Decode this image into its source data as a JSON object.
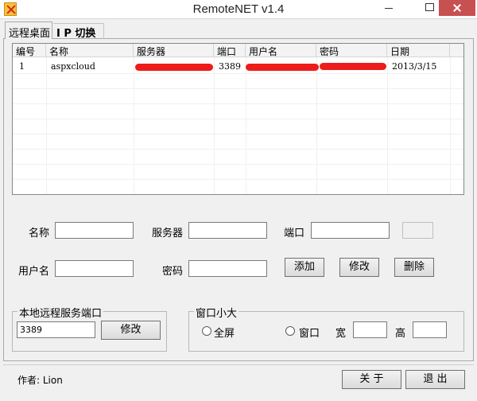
{
  "window": {
    "title": "RemoteNET v1.4"
  },
  "tabs": [
    {
      "label": "远程桌面"
    },
    {
      "label": "I P 切换"
    }
  ],
  "list": {
    "columns": [
      "编号",
      "名称",
      "服务器",
      "端口",
      "用户名",
      "密码",
      "日期"
    ],
    "rows": [
      {
        "id": "1",
        "name": "aspxcloud",
        "server": "",
        "port": "3389",
        "user": "",
        "password": "",
        "date": "2013/3/15"
      }
    ]
  },
  "form": {
    "name_label": "名称",
    "server_label": "服务器",
    "port_label": "端口",
    "user_label": "用户名",
    "password_label": "密码",
    "name_value": "",
    "server_value": "",
    "port_value": "",
    "user_value": "",
    "password_value": "",
    "add_label": "添加",
    "edit_label": "修改",
    "delete_label": "删除"
  },
  "local_port": {
    "title": "本地远程服务端口",
    "value": "3389",
    "edit_label": "修改"
  },
  "window_size": {
    "title": "窗口小大",
    "fullscreen_label": "全屏",
    "window_label": "窗口",
    "width_label": "宽",
    "height_label": "高",
    "width_value": "",
    "height_value": ""
  },
  "footer": {
    "author": "作者: Lion",
    "about_label": "关 于",
    "exit_label": "退 出"
  },
  "colors": {
    "redaction": "#ee1b1b",
    "close_button": "#c75050"
  }
}
